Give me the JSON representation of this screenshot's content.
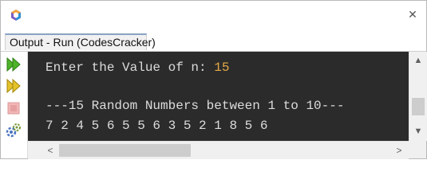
{
  "window": {
    "close_glyph": "✕"
  },
  "tab": {
    "label": "Output - Run (CodesCracker)"
  },
  "console": {
    "prompt_text": "Enter the Value of n: ",
    "prompt_value": "15",
    "heading": "---15 Random Numbers between 1 to 10---",
    "numbers": "7 2 4 5 6 5 5 6 3 5 2 1 8 5 6"
  },
  "toolbar": {
    "icons": [
      "rerun-icon",
      "rerun-with-options-icon",
      "stop-icon",
      "settings-icon"
    ]
  },
  "scrollbars": {
    "up": "▲",
    "down": "▼",
    "left": "<",
    "right": ">"
  },
  "colors": {
    "console_bg": "#2b2b2b",
    "console_text": "#dcdcdc",
    "input_value": "#e6a847",
    "run_green": "#4fb32a"
  }
}
